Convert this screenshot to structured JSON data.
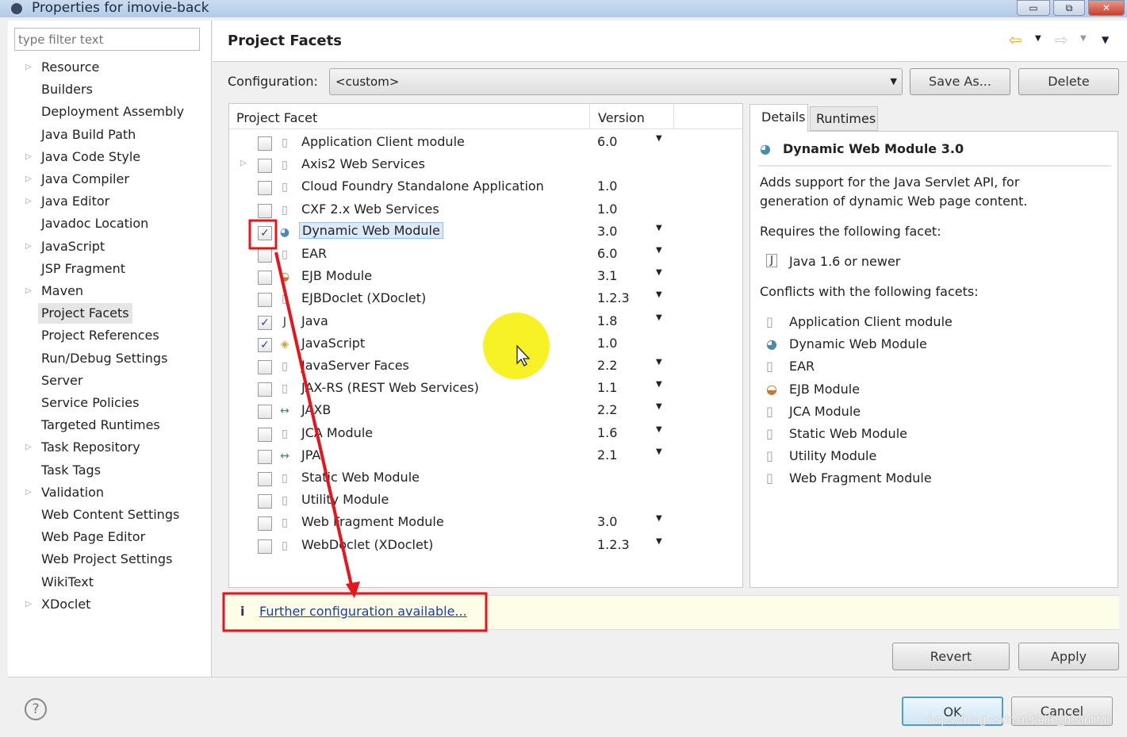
{
  "window": {
    "title": "Properties for imovie-back",
    "minimize": "▭",
    "restore": "⧉",
    "close": "✕"
  },
  "filter": {
    "placeholder": "type filter text"
  },
  "nav": [
    {
      "label": "Resource",
      "expandable": true
    },
    {
      "label": "Builders"
    },
    {
      "label": "Deployment Assembly"
    },
    {
      "label": "Java Build Path"
    },
    {
      "label": "Java Code Style",
      "expandable": true
    },
    {
      "label": "Java Compiler",
      "expandable": true
    },
    {
      "label": "Java Editor",
      "expandable": true
    },
    {
      "label": "Javadoc Location"
    },
    {
      "label": "JavaScript",
      "expandable": true
    },
    {
      "label": "JSP Fragment"
    },
    {
      "label": "Maven",
      "expandable": true
    },
    {
      "label": "Project Facets",
      "selected": true
    },
    {
      "label": "Project References"
    },
    {
      "label": "Run/Debug Settings"
    },
    {
      "label": "Server"
    },
    {
      "label": "Service Policies"
    },
    {
      "label": "Targeted Runtimes"
    },
    {
      "label": "Task Repository",
      "expandable": true
    },
    {
      "label": "Task Tags"
    },
    {
      "label": "Validation",
      "expandable": true
    },
    {
      "label": "Web Content Settings"
    },
    {
      "label": "Web Page Editor"
    },
    {
      "label": "Web Project Settings"
    },
    {
      "label": "WikiText"
    },
    {
      "label": "XDoclet",
      "expandable": true
    }
  ],
  "page": {
    "title": "Project Facets",
    "config_label": "Configuration:",
    "config_value": "<custom>",
    "save_as": "Save As...",
    "delete": "Delete"
  },
  "table": {
    "col_facet": "Project Facet",
    "col_version": "Version",
    "rows": [
      {
        "name": "Application Client module",
        "version": "6.0",
        "checked": false,
        "dropdown": true
      },
      {
        "name": "Axis2 Web Services",
        "version": "",
        "checked": false,
        "expandable": true
      },
      {
        "name": "Cloud Foundry Standalone Application",
        "version": "1.0",
        "checked": false
      },
      {
        "name": "CXF 2.x Web Services",
        "version": "1.0",
        "checked": false
      },
      {
        "name": "Dynamic Web Module",
        "version": "3.0",
        "checked": true,
        "dropdown": true,
        "selected": true
      },
      {
        "name": "EAR",
        "version": "6.0",
        "checked": false,
        "dropdown": true
      },
      {
        "name": "EJB Module",
        "version": "3.1",
        "checked": false,
        "dropdown": true
      },
      {
        "name": "EJBDoclet (XDoclet)",
        "version": "1.2.3",
        "checked": false,
        "dropdown": true
      },
      {
        "name": "Java",
        "version": "1.8",
        "checked": true,
        "dropdown": true
      },
      {
        "name": "JavaScript",
        "version": "1.0",
        "checked": true
      },
      {
        "name": "JavaServer Faces",
        "version": "2.2",
        "checked": false,
        "dropdown": true
      },
      {
        "name": "JAX-RS (REST Web Services)",
        "version": "1.1",
        "checked": false,
        "dropdown": true
      },
      {
        "name": "JAXB",
        "version": "2.2",
        "checked": false,
        "dropdown": true
      },
      {
        "name": "JCA Module",
        "version": "1.6",
        "checked": false,
        "dropdown": true
      },
      {
        "name": "JPA",
        "version": "2.1",
        "checked": false,
        "dropdown": true
      },
      {
        "name": "Static Web Module",
        "version": "",
        "checked": false
      },
      {
        "name": "Utility Module",
        "version": "",
        "checked": false
      },
      {
        "name": "Web Fragment Module",
        "version": "3.0",
        "checked": false,
        "dropdown": true
      },
      {
        "name": "WebDoclet (XDoclet)",
        "version": "1.2.3",
        "checked": false,
        "dropdown": true
      }
    ]
  },
  "details": {
    "tab_details": "Details",
    "tab_runtimes": "Runtimes",
    "title": "Dynamic Web Module 3.0",
    "desc1": "Adds support for the Java Servlet API, for",
    "desc2": "generation of dynamic Web page content.",
    "requires_label": "Requires the following facet:",
    "requires": "Java 1.6 or newer",
    "conflicts_label": "Conflicts with the following facets:",
    "conflicts": [
      "Application Client module",
      "Dynamic Web Module",
      "EAR",
      "EJB Module",
      "JCA Module",
      "Static Web Module",
      "Utility Module",
      "Web Fragment Module"
    ]
  },
  "info": {
    "icon": "i",
    "link": "Further configuration available..."
  },
  "buttons": {
    "revert": "Revert",
    "apply": "Apply",
    "ok": "OK",
    "cancel": "Cancel",
    "help": "?"
  },
  "watermark": "https://blog.csdn.net/dlrb_beautiful",
  "colors": {
    "annotation": "#e8141b",
    "highlight": "#f5f000",
    "link": "#1a3ea8"
  }
}
